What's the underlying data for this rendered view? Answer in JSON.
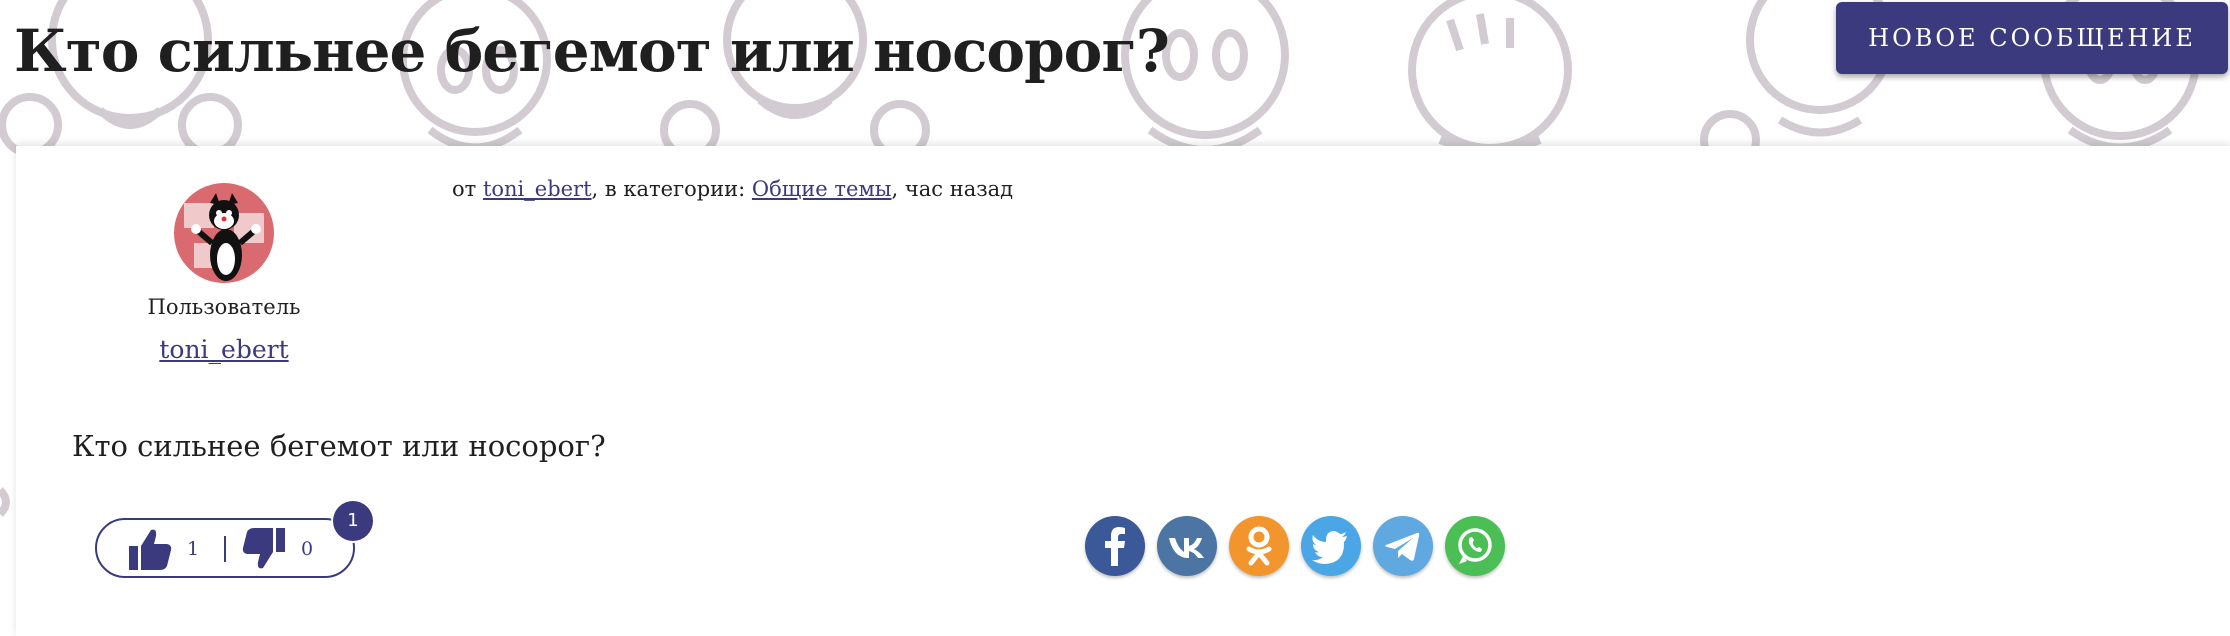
{
  "header": {
    "title": "Кто сильнее бегемот или носорог?",
    "new_message_button": "НОВОЕ СООБЩЕНИЕ"
  },
  "post": {
    "author": {
      "role": "Пользователь",
      "username": "toni_ebert",
      "avatar_icon": "cartoon-cat-avatar"
    },
    "meta": {
      "prefix": "от ",
      "author_link": "toni_ebert",
      "category_prefix": ", в категории: ",
      "category_link": "Общие темы",
      "time_suffix": ", час назад"
    },
    "body": "Кто сильнее бегемот или носорог?",
    "votes": {
      "up_count": "1",
      "down_count": "0",
      "badge": "1"
    },
    "share": [
      {
        "network": "facebook",
        "icon": "facebook-icon",
        "color": "#3b5998"
      },
      {
        "network": "vk",
        "icon": "vk-icon",
        "color": "#4c75a3"
      },
      {
        "network": "odnoklassniki",
        "icon": "odnoklassniki-icon",
        "color": "#f2952c"
      },
      {
        "network": "twitter",
        "icon": "twitter-icon",
        "color": "#4ba6e6"
      },
      {
        "network": "telegram",
        "icon": "telegram-icon",
        "color": "#5fa8e0"
      },
      {
        "network": "whatsapp",
        "icon": "whatsapp-icon",
        "color": "#4bbf55"
      }
    ]
  },
  "colors": {
    "accent": "#3c3a7e",
    "background_doodle": "#cfc9cf",
    "text": "#1f1f1f"
  }
}
